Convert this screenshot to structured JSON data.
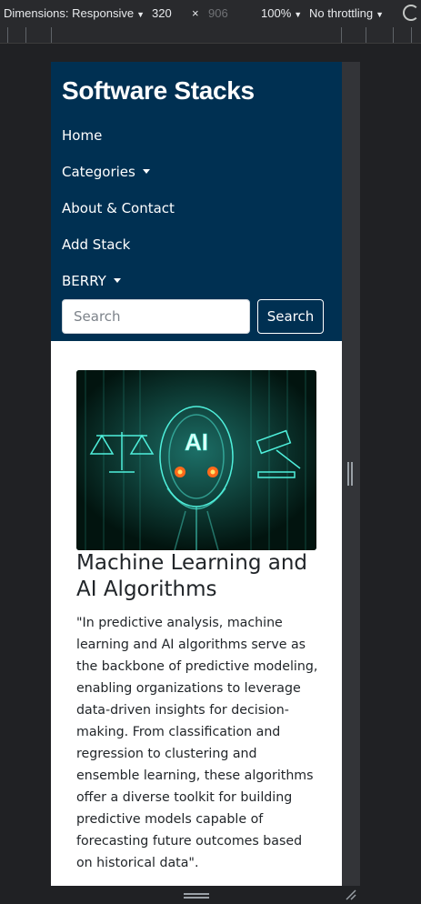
{
  "devtools": {
    "dimensions_label": "Dimensions: Responsive",
    "width": "320",
    "times": "×",
    "height": "906",
    "zoom": "100%",
    "throttling": "No throttling"
  },
  "site": {
    "brand": "Software Stacks",
    "nav": {
      "home": "Home",
      "categories": "Categories",
      "about": "About & Contact",
      "add_stack": "Add Stack",
      "user": "BERRY"
    },
    "search": {
      "placeholder": "Search",
      "button": "Search"
    }
  },
  "article": {
    "image_text": "AI",
    "title": "Machine Learning and AI Algorithms",
    "body": "\"In predictive analysis, machine learning and AI algorithms serve as the backbone of predictive modeling, enabling organizations to leverage data-driven insights for decision-making. From classification and regression to clustering and ensemble learning, these algorithms offer a diverse toolkit for building predictive models capable of forecasting future outcomes based on historical data\"."
  },
  "colors": {
    "nav_bg": "#003052",
    "devtools_bg": "#202124",
    "image_glow": "#43e6d4"
  }
}
